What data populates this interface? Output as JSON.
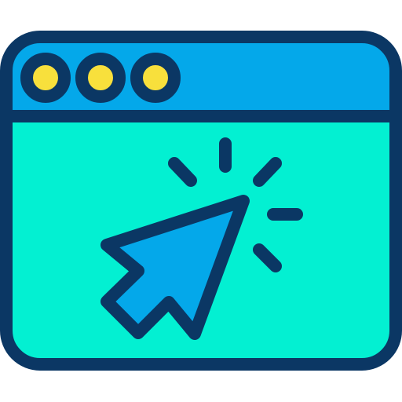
{
  "icon": {
    "name": "browser-window-click-icon",
    "colors": {
      "outline": "#0b3764",
      "titlebar": "#04a8ea",
      "content": "#03f0d2",
      "window_dots": "#f8e03c",
      "cursor": "#04a8ea"
    },
    "window_buttons": [
      "window-dot-1",
      "window-dot-2",
      "window-dot-3"
    ]
  }
}
